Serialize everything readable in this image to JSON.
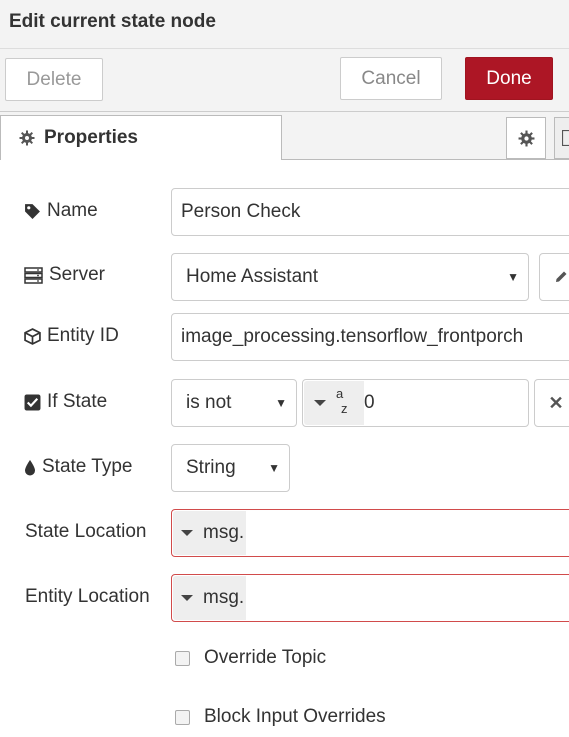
{
  "header": {
    "title": "Edit current state node"
  },
  "toolbar": {
    "delete_label": "Delete",
    "cancel_label": "Cancel",
    "done_label": "Done"
  },
  "tabs": {
    "properties_label": "Properties"
  },
  "form": {
    "name": {
      "label": "Name",
      "value": "Person Check"
    },
    "server": {
      "label": "Server",
      "selected": "Home Assistant"
    },
    "entity_id": {
      "label": "Entity ID",
      "value": "image_processing.tensorflow_frontporch"
    },
    "if_state": {
      "label": "If State",
      "operator": "is not",
      "type_glyph": "a z",
      "value": "0"
    },
    "state_type": {
      "label": "State Type",
      "selected": "String"
    },
    "state_location": {
      "label": "State Location",
      "prefix": "msg.",
      "value": ""
    },
    "entity_location": {
      "label": "Entity Location",
      "prefix": "msg.",
      "value": ""
    },
    "override_topic": {
      "label": "Override Topic",
      "checked": false
    },
    "block_input_overrides": {
      "label": "Block Input Overrides",
      "checked": false
    }
  },
  "colors": {
    "done": "#ad1625",
    "error_border": "#d14b4b"
  }
}
